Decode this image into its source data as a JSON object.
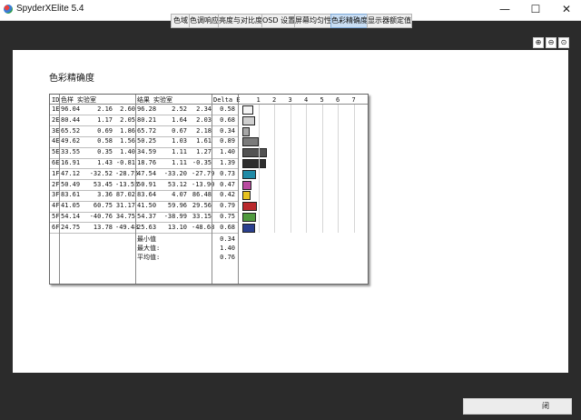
{
  "window": {
    "title": "SpyderXElite 5.4",
    "controls": [
      "—",
      "☐",
      "✕"
    ]
  },
  "tabs": [
    {
      "label": "色域",
      "active": false
    },
    {
      "label": "色调响应",
      "active": false
    },
    {
      "label": "亮度与对比度",
      "active": false
    },
    {
      "label": "OSD 设置",
      "active": false
    },
    {
      "label": "屏幕均匀性",
      "active": false
    },
    {
      "label": "色彩精确度",
      "active": true
    },
    {
      "label": "显示器额定值",
      "active": false
    }
  ],
  "zoom": {
    "zoom_in": "⊕",
    "zoom_out": "⊖",
    "zoom_fit": "⊙"
  },
  "page": {
    "title": "色彩精确度"
  },
  "table": {
    "headers": {
      "id": "ID",
      "sample": "色样",
      "lab1": "实验室",
      "result": "结果",
      "lab2": "实验室",
      "delta": "Delta E"
    },
    "scale": [
      "1",
      "2",
      "3",
      "4",
      "5",
      "6",
      "7"
    ],
    "rows": [
      {
        "id": "1E",
        "l1": "96.04",
        "a1": "2.16",
        "b1": "2.60",
        "l2": "96.28",
        "a2": "2.52",
        "b2": "2.34",
        "de": "0.58",
        "de_val": 0.58,
        "color": "#f4f4f4"
      },
      {
        "id": "2E",
        "l1": "80.44",
        "a1": "1.17",
        "b1": "2.05",
        "l2": "80.21",
        "a2": "1.64",
        "b2": "2.03",
        "de": "0.68",
        "de_val": 0.68,
        "color": "#cfcfcf"
      },
      {
        "id": "3E",
        "l1": "65.52",
        "a1": "0.69",
        "b1": "1.86",
        "l2": "65.72",
        "a2": "0.67",
        "b2": "2.18",
        "de": "0.34",
        "de_val": 0.34,
        "color": "#a7a7a7"
      },
      {
        "id": "4E",
        "l1": "49.62",
        "a1": "0.58",
        "b1": "1.56",
        "l2": "50.25",
        "a2": "1.03",
        "b2": "1.61",
        "de": "0.89",
        "de_val": 0.89,
        "color": "#7b7b7b"
      },
      {
        "id": "5E",
        "l1": "33.55",
        "a1": "0.35",
        "b1": "1.40",
        "l2": "34.59",
        "a2": "1.11",
        "b2": "1.27",
        "de": "1.40",
        "de_val": 1.4,
        "color": "#525252"
      },
      {
        "id": "6E",
        "l1": "16.91",
        "a1": "1.43",
        "b1": "-0.81",
        "l2": "18.76",
        "a2": "1.11",
        "b2": "-0.35",
        "de": "1.39",
        "de_val": 1.39,
        "color": "#2e2e2e"
      },
      {
        "id": "1F",
        "l1": "47.12",
        "a1": "-32.52",
        "b1": "-28.75",
        "l2": "47.54",
        "a2": "-33.20",
        "b2": "-27.79",
        "de": "0.73",
        "de_val": 0.73,
        "color": "#1f8aa6"
      },
      {
        "id": "2F",
        "l1": "50.49",
        "a1": "53.45",
        "b1": "-13.55",
        "l2": "50.91",
        "a2": "53.12",
        "b2": "-13.90",
        "de": "0.47",
        "de_val": 0.47,
        "color": "#b94aa0"
      },
      {
        "id": "3F",
        "l1": "83.61",
        "a1": "3.36",
        "b1": "87.02",
        "l2": "83.64",
        "a2": "4.07",
        "b2": "86.48",
        "de": "0.42",
        "de_val": 0.42,
        "color": "#e7c21e"
      },
      {
        "id": "4F",
        "l1": "41.05",
        "a1": "60.75",
        "b1": "31.17",
        "l2": "41.50",
        "a2": "59.96",
        "b2": "29.56",
        "de": "0.79",
        "de_val": 0.79,
        "color": "#b9282c"
      },
      {
        "id": "5F",
        "l1": "54.14",
        "a1": "-40.76",
        "b1": "34.75",
        "l2": "54.37",
        "a2": "-38.99",
        "b2": "33.15",
        "de": "0.75",
        "de_val": 0.75,
        "color": "#4f9a3e"
      },
      {
        "id": "6F",
        "l1": "24.75",
        "a1": "13.78",
        "b1": "-49.48",
        "l2": "25.63",
        "a2": "13.10",
        "b2": "-48.68",
        "de": "0.68",
        "de_val": 0.68,
        "color": "#2a3f8f"
      }
    ],
    "summary": [
      {
        "label": "最小值",
        "value": "0.34"
      },
      {
        "label": "最大值:",
        "value": "1.40"
      },
      {
        "label": "平均值:",
        "value": "0.76"
      }
    ]
  },
  "footer": {
    "next_label": "闭"
  }
}
